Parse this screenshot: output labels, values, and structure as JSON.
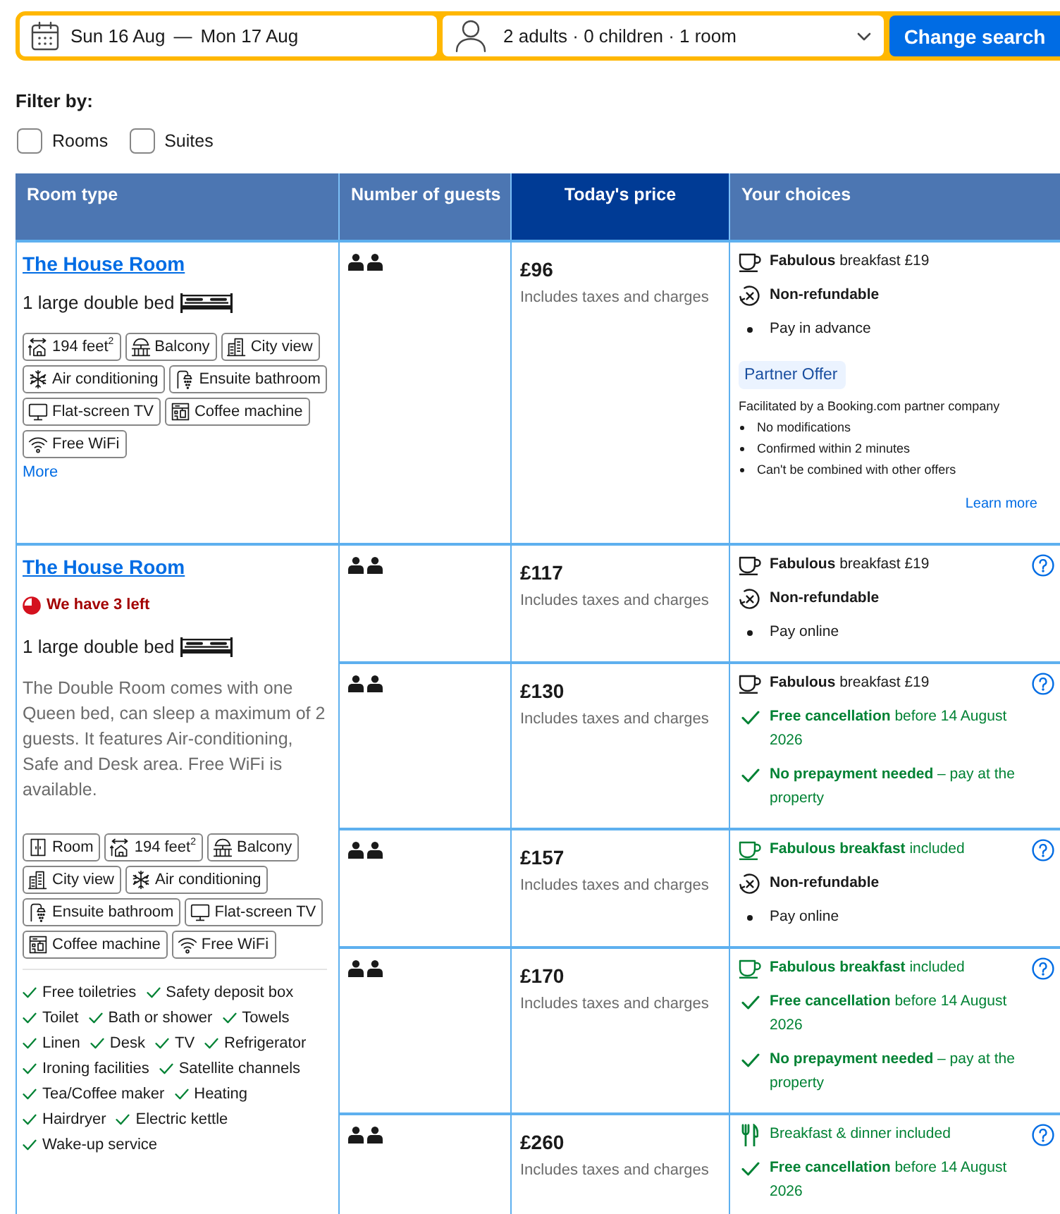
{
  "search": {
    "dates": {
      "checkin": "Sun 16 Aug",
      "separator": "—",
      "checkout": "Mon 17 Aug"
    },
    "occupancy": "2 adults · 0 children · 1 room",
    "button": "Change search"
  },
  "filters": {
    "label": "Filter by:",
    "options": [
      {
        "label": "Rooms",
        "checked": false
      },
      {
        "label": "Suites",
        "checked": false
      }
    ]
  },
  "table": {
    "columns": [
      {
        "label": "Room type",
        "highlighted": false
      },
      {
        "label": "Number of guests",
        "highlighted": false
      },
      {
        "label": "Today's price",
        "highlighted": true
      },
      {
        "label": "Your choices",
        "highlighted": false
      }
    ],
    "rooms": [
      {
        "name": "The House Room",
        "bed": "1 large double bed",
        "facilities": [
          {
            "kind": "size",
            "label": "194 feet$^{2}$"
          },
          {
            "kind": "balcony",
            "label": "Balcony"
          },
          {
            "kind": "city-view",
            "label": "City view"
          },
          {
            "kind": "air-conditioning",
            "label": "Air conditioning"
          },
          {
            "kind": "bathroom",
            "label": "Ensuite bathroom"
          },
          {
            "kind": "tv",
            "label": "Flat-screen TV"
          },
          {
            "kind": "coffee-machine",
            "label": "Coffee machine"
          },
          {
            "kind": "wifi",
            "label": "Free WiFi"
          }
        ],
        "more_link": "More",
        "offers": [
          {
            "price": "£96",
            "price_note": "Includes taxes and charges",
            "help": false,
            "choices": [
              {
                "kind": "breakfast",
                "included": false,
                "text": "**Fabulous** breakfast £19"
              },
              {
                "kind": "non-refundable",
                "text": "Non-refundable"
              },
              {
                "kind": "payment",
                "text": "Pay in advance"
              }
            ],
            "partner_offer": {
              "badge": "Partner Offer",
              "note": "Facilitated by a Booking.com partner company",
              "conditions": [
                "No modifications",
                "Confirmed within 2 minutes",
                "Can't be combined with other offers"
              ],
              "link": "Learn more"
            }
          }
        ]
      },
      {
        "name": "The House Room",
        "availability": "We have 3 left",
        "bed": "1 large double bed",
        "description": "The Double Room comes with one Queen bed, can sleep a maximum of 2 guests. It features Air-conditioning, Safe and Desk area. Free WiFi is available.",
        "facilities": [
          {
            "kind": "room",
            "label": "Room"
          },
          {
            "kind": "size",
            "label": "194 feet$^{2}$"
          },
          {
            "kind": "balcony",
            "label": "Balcony"
          },
          {
            "kind": "city-view",
            "label": "City view"
          },
          {
            "kind": "air-conditioning",
            "label": "Air conditioning"
          },
          {
            "kind": "bathroom",
            "label": "Ensuite bathroom"
          },
          {
            "kind": "tv",
            "label": "Flat-screen TV"
          },
          {
            "kind": "coffee-machine",
            "label": "Coffee machine"
          },
          {
            "kind": "wifi",
            "label": "Free WiFi"
          }
        ],
        "amenities": [
          "Free toiletries",
          "Safety deposit box",
          "Toilet",
          "Bath or shower",
          "Towels",
          "Linen",
          "Desk",
          "TV",
          "Refrigerator",
          "Ironing facilities",
          "Satellite channels",
          "Tea/Coffee maker",
          "Heating",
          "Hairdryer",
          "Electric kettle",
          "Wake-up service"
        ],
        "offers": [
          {
            "price": "£117",
            "price_note": "Includes taxes and charges",
            "help": true,
            "choices": [
              {
                "kind": "breakfast",
                "included": false,
                "text": "**Fabulous** breakfast £19"
              },
              {
                "kind": "non-refundable",
                "text": "Non-refundable"
              },
              {
                "kind": "payment",
                "text": "Pay online"
              }
            ]
          },
          {
            "price": "£130",
            "price_note": "Includes taxes and charges",
            "help": true,
            "choices": [
              {
                "kind": "breakfast",
                "included": false,
                "text": "**Fabulous** breakfast £19"
              },
              {
                "kind": "free-cancellation",
                "text": "**Free cancellation** before 14 August 2026"
              },
              {
                "kind": "no-prepayment",
                "text": "**No prepayment needed** – pay at the property"
              }
            ]
          },
          {
            "price": "£157",
            "price_note": "Includes taxes and charges",
            "help": true,
            "choices": [
              {
                "kind": "breakfast",
                "included": true,
                "text": "**Fabulous breakfast** included"
              },
              {
                "kind": "non-refundable",
                "text": "Non-refundable"
              },
              {
                "kind": "payment",
                "text": "Pay online"
              }
            ]
          },
          {
            "price": "£170",
            "price_note": "Includes taxes and charges",
            "help": true,
            "choices": [
              {
                "kind": "breakfast",
                "included": true,
                "text": "**Fabulous breakfast** included"
              },
              {
                "kind": "free-cancellation",
                "text": "**Free cancellation** before 14 August 2026"
              },
              {
                "kind": "no-prepayment",
                "text": "**No prepayment needed** – pay at the property"
              }
            ]
          },
          {
            "price": "£260",
            "price_note": "Includes taxes and charges",
            "help": true,
            "choices": [
              {
                "kind": "half-board",
                "included": true,
                "text": "Breakfast & dinner included"
              },
              {
                "kind": "free-cancellation",
                "text": "**Free cancellation** before 14 August 2026"
              }
            ]
          }
        ]
      }
    ]
  }
}
